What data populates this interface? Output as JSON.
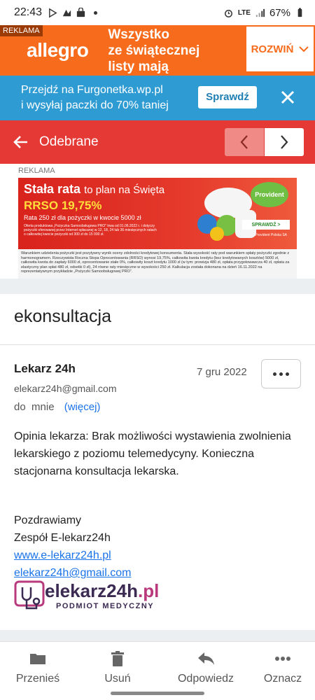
{
  "status_bar": {
    "time": "22:43",
    "network": "LTE",
    "battery": "67%"
  },
  "allegro_ad": {
    "tag": "REKLAMA",
    "logo": "allegro",
    "text_line1": "Wszystko",
    "text_line2": "ze świątecznej",
    "text_line3": "listy mają",
    "button": "ROZWIŃ"
  },
  "furgonetka_banner": {
    "line1": "Przejdź na Furgonetka.wp.pl",
    "line2": "i wysyłaj paczki do 70% taniej",
    "button": "Sprawdź"
  },
  "header": {
    "title": "Odebrane"
  },
  "provident_ad": {
    "label": "REKLAMA",
    "title_bold": "Stała rata",
    "title_thin": "to plan na Święta",
    "rrso": "RRSO 19,75%",
    "sub": "Rata 250 zł dla pożyczki w kwocie 5000 zł",
    "small": "Oferta produktowa „Pożyczka Samoobsługowa PRO” trwa od 01.06.2022 r. i dotyczy pożyczki oferowanej przez Internet spłacanej w 12, 18, 24 lub 36 miesięcznych ratach o całkowitej kwocie pożyczki od 300 zł do 15 000 zł.",
    "logo": "Provident",
    "button": "SPRAWDŹ >",
    "company": "Provident Polska SA",
    "legal": "Warunkiem udzielenia pożyczki jest pozytywny wynik oceny zdolności kredytowej konsumenta. Stała wysokość raty pod warunkiem spłaty pożyczki zgodnie z harmonogramem. Rzeczywista Roczna Stopa Oprocentowania (RRSO) wynosi 19,75%, całkowita kwota kredytu (bez kredytowanych kosztów) 5000 zł, całkowita kwota do zapłaty 6000 zł, oprocentowanie stałe 0%, całkowity koszt kredytu 1000 zł (w tym: prowizja 480 zł, opłata przygotowawcza 40 zł, opłata za elastyczny plan spłat 480 zł, odsetki 0 zł), 24 równe raty miesięczne w wysokości 250 zł. Kalkulacja została dokonana na dzień 16.11.2022 na reprezentatywnym przykładzie „Pożyczki Samoobsługowej PRO”."
  },
  "email": {
    "subject": "ekonsultacja",
    "sender_name": "Lekarz 24h",
    "sender_email": "elekarz24h@gmail.com",
    "date": "7 gru 2022",
    "to_label": "do",
    "to_value": "mnie",
    "more_link": "(więcej)",
    "body": "Opinia lekarza: Brak możliwości wystawienia zwolnienia lekarskiego z poziomu telemedycyny. Konieczna stacjonarna konsultacja lekarska.",
    "sig_line1": "Pozdrawiamy",
    "sig_line2": "Zespół E-lekarz24h",
    "sig_link1": "www.e-lekarz24h.pl",
    "sig_link2": "elekarz24h@gmail.com",
    "logo_name": "elekarz24h",
    "logo_tld": ".pl",
    "logo_sub": "PODMIOT MEDYCZNY"
  },
  "actions": [
    {
      "label": "Przenieś",
      "icon": "folder-icon"
    },
    {
      "label": "Usuń",
      "icon": "trash-icon"
    },
    {
      "label": "Odpowiedz",
      "icon": "reply-icon"
    },
    {
      "label": "Oznacz",
      "icon": "more-dots-icon"
    }
  ],
  "colors": {
    "allegro_orange": "#f76b1c",
    "banner_blue": "#2f9bd3",
    "header_red": "#e53935",
    "link_blue": "#1a73e8"
  }
}
